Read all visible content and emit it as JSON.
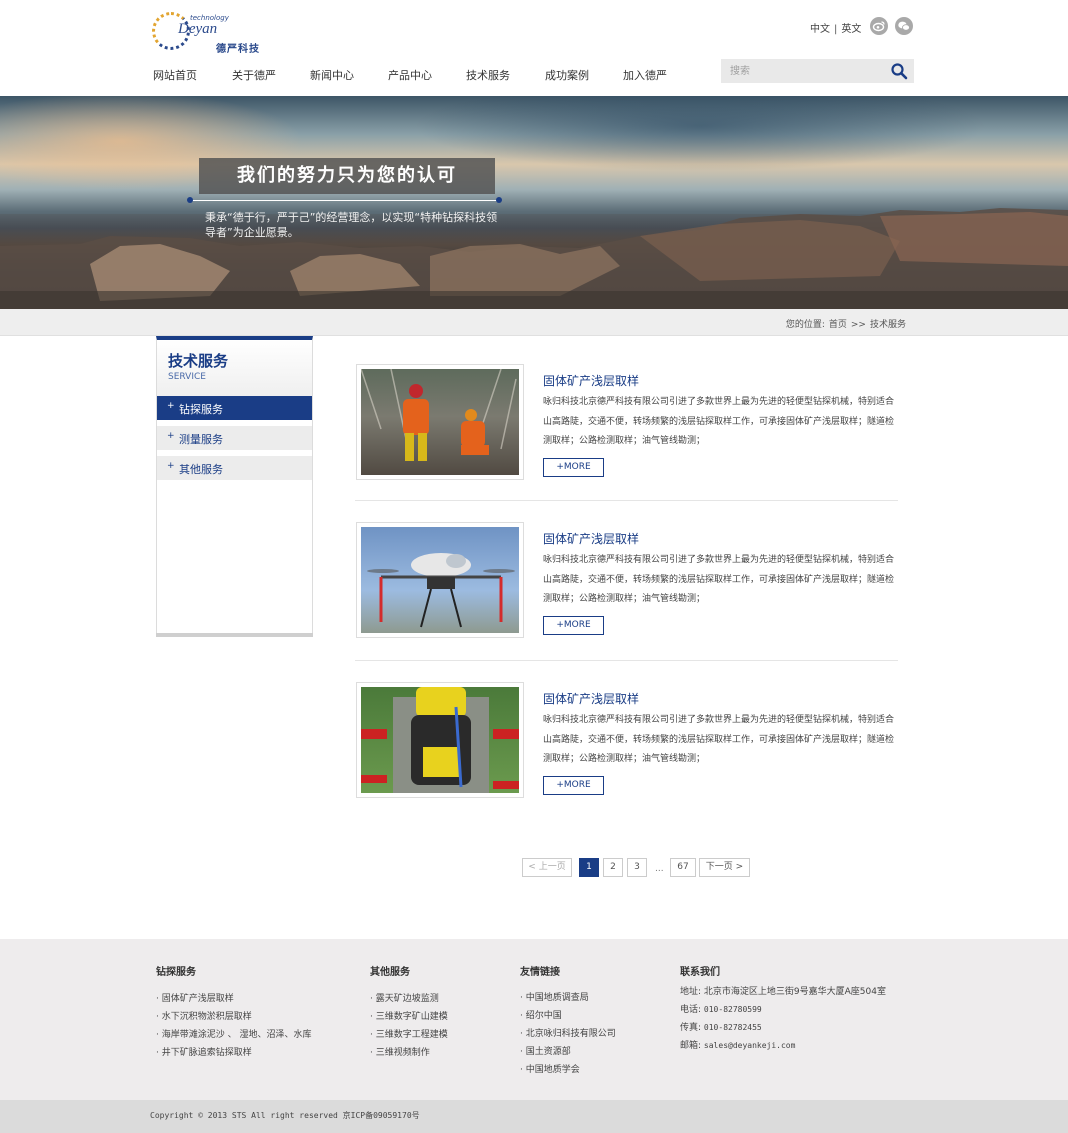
{
  "header": {
    "logo_text": "Deyan",
    "logo_sub": "technology",
    "logo_cn": "德严科技",
    "lang": {
      "cn": "中文",
      "sep": "|",
      "en": "英文"
    },
    "social": [
      {
        "icon": "weibo-icon"
      },
      {
        "icon": "wechat-icon"
      }
    ],
    "nav": [
      "网站首页",
      "关于德严",
      "新闻中心",
      "产品中心",
      "技术服务",
      "成功案例",
      "加入德严"
    ],
    "search_placeholder": "搜索"
  },
  "banner": {
    "title": "我们的努力只为您的认可",
    "subtitle": "秉承“德于行，严于己”的经营理念，以实现“特种钻探科技领导者”为企业愿景。"
  },
  "breadcrumb": {
    "prefix": "您的位置:",
    "home": "首页",
    "sep": ">>",
    "current": "技术服务"
  },
  "sidebar": {
    "title": "技术服务",
    "subtitle": "SERVICE",
    "items": [
      {
        "label": "钻探服务",
        "active": true
      },
      {
        "label": "测量服务",
        "active": false
      },
      {
        "label": "其他服务",
        "active": false
      }
    ]
  },
  "articles": [
    {
      "title": "固体矿产浅层取样",
      "body": "咏归科技北京德严科技有限公司引进了多款世界上最为先进的轻便型钻探机械，特别适合山高路陡，交通不便，转场频繁的浅层钻探取样工作，可承接固体矿产浅层取样；隧道检测取样；公路检测取样；油气管线勘测；",
      "more": "+MORE"
    },
    {
      "title": "固体矿产浅层取样",
      "body": "咏归科技北京德严科技有限公司引进了多款世界上最为先进的轻便型钻探机械，特别适合山高路陡，交通不便，转场频繁的浅层钻探取样工作，可承接固体矿产浅层取样；隧道检测取样；公路检测取样；油气管线勘测；",
      "more": "+MORE"
    },
    {
      "title": "固体矿产浅层取样",
      "body": "咏归科技北京德严科技有限公司引进了多款世界上最为先进的轻便型钻探机械，特别适合山高路陡，交通不便，转场频繁的浅层钻探取样工作，可承接固体矿产浅层取样；隧道检测取样；公路检测取样；油气管线勘测；",
      "more": "+MORE"
    }
  ],
  "pagination": {
    "prev": "< 上一页",
    "pages": [
      "1",
      "2",
      "3"
    ],
    "ellipsis": "...",
    "last": "67",
    "next": "下一页 >",
    "current": "1"
  },
  "footer": {
    "col1": {
      "title": "钻探服务",
      "items": [
        "· 固体矿产浅层取样",
        "· 水下沉积物淤积层取样",
        "· 海岸带滩涂泥沙 、 湿地、沼泽、水库",
        "· 井下矿脉追索钻探取样"
      ]
    },
    "col2": {
      "title": "其他服务",
      "items": [
        "· 露天矿边坡监测",
        "· 三维数字矿山建模",
        "· 三维数字工程建模",
        "· 三维视频制作"
      ]
    },
    "col3": {
      "title": "友情链接",
      "items": [
        "· 中国地质调查局",
        "· 绍尔中国",
        "· 北京咏归科技有限公司",
        "· 国土资源部",
        "· 中国地质学会"
      ]
    },
    "col4": {
      "title": "联系我们",
      "address": "地址: 北京市海淀区上地三街9号嘉华大厦A座504室",
      "phone_label": "电话:",
      "phone": "010-82780599",
      "fax_label": "传真:",
      "fax": "010-82782455",
      "email_label": "邮箱:",
      "email": "sales@deyankeji.com"
    },
    "copyright": "Copyright © 2013 STS All right reserved 京ICP备09059170号"
  },
  "colors": {
    "accent": "#1a3d86",
    "footer_bg": "#eeeced"
  }
}
